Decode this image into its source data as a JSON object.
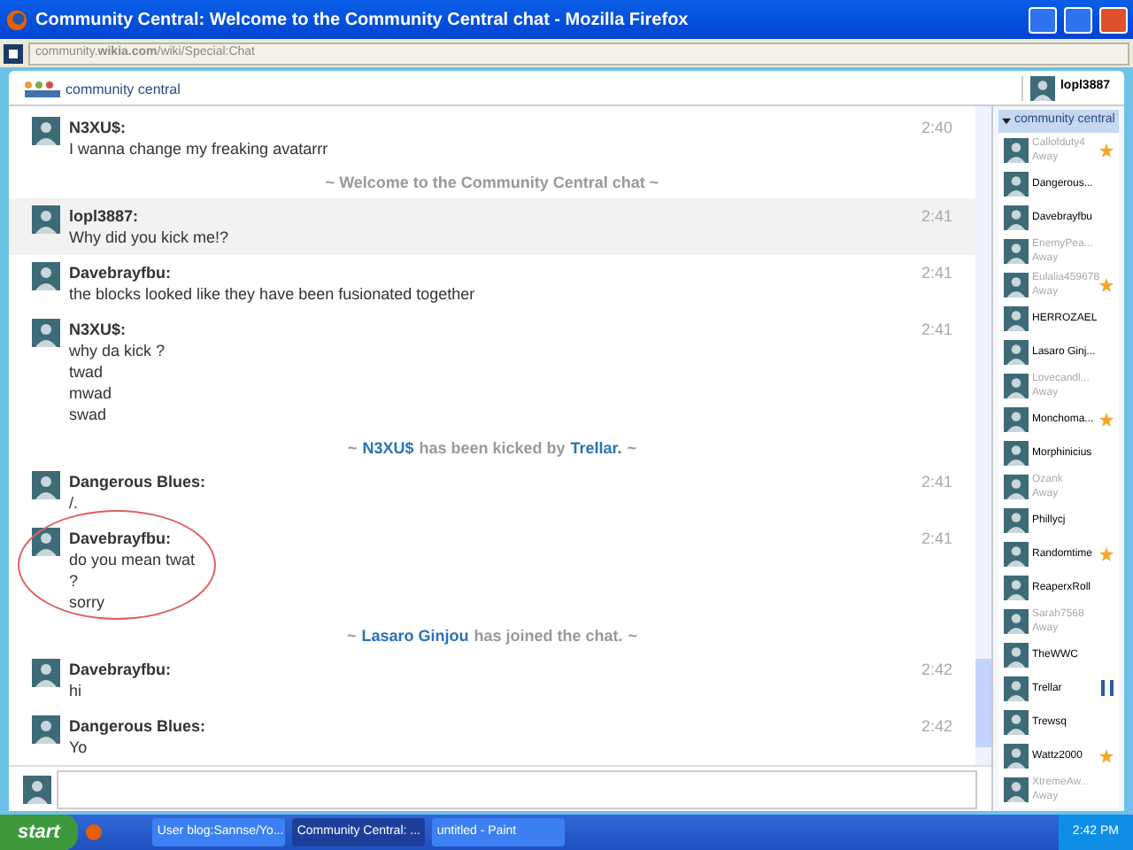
{
  "window": {
    "title": "Community Central: Welcome to the Community Central chat - Mozilla Firefox"
  },
  "address": "community.**wikia.com**/wiki/Special:Chat",
  "header": {
    "logo": "community central",
    "user": "lopl3887"
  },
  "messages": [
    {
      "kind": "message",
      "user": "N3XU$:",
      "time": "2:40",
      "lines": [
        "I wanna change my freaking avatarrr"
      ],
      "highlighted": false,
      "circled": false
    },
    {
      "kind": "notice",
      "parts": [
        {
          "text": "~ Welcome to the Community Central chat ~",
          "link": false
        }
      ]
    },
    {
      "kind": "message",
      "user": "lopl3887:",
      "time": "2:41",
      "lines": [
        "Why did you kick me!?"
      ],
      "highlighted": true,
      "circled": false
    },
    {
      "kind": "message",
      "user": "Davebrayfbu:",
      "time": "2:41",
      "lines": [
        "the blocks looked like they have been fusionated together"
      ],
      "highlighted": false,
      "circled": false
    },
    {
      "kind": "message",
      "user": "N3XU$:",
      "time": "2:41",
      "lines": [
        "why da kick ?",
        "twad",
        "mwad",
        "swad"
      ],
      "highlighted": false,
      "circled": false
    },
    {
      "kind": "notice",
      "parts": [
        {
          "text": "~",
          "link": false
        },
        {
          "text": "N3XU$",
          "link": true
        },
        {
          "text": "has been kicked by",
          "link": false
        },
        {
          "text": "Trellar.",
          "link": true
        },
        {
          "text": "~",
          "link": false
        }
      ]
    },
    {
      "kind": "message",
      "user": "Dangerous Blues:",
      "time": "2:41",
      "lines": [
        "/."
      ],
      "highlighted": false,
      "circled": false
    },
    {
      "kind": "message",
      "user": "Davebrayfbu:",
      "time": "2:41",
      "lines": [
        "do you mean twat",
        "?",
        "sorry"
      ],
      "highlighted": false,
      "circled": true
    },
    {
      "kind": "notice",
      "parts": [
        {
          "text": "~",
          "link": false
        },
        {
          "text": "Lasaro Ginjou",
          "link": true
        },
        {
          "text": "has joined the chat.",
          "link": false
        },
        {
          "text": "~",
          "link": false
        }
      ]
    },
    {
      "kind": "message",
      "user": "Davebrayfbu:",
      "time": "2:42",
      "lines": [
        "hi"
      ],
      "highlighted": false,
      "circled": false
    },
    {
      "kind": "message",
      "user": "Dangerous Blues:",
      "time": "2:42",
      "lines": [
        "Yo"
      ],
      "highlighted": false,
      "circled": false
    }
  ],
  "userlist": {
    "title": "community central",
    "expanded": true,
    "users": [
      {
        "name": "Callofduty4",
        "status": "Away",
        "away": true,
        "starred": true,
        "moderator": false
      },
      {
        "name": "Dangerous...",
        "away": false,
        "starred": false,
        "moderator": false
      },
      {
        "name": "Davebrayfbu",
        "away": false,
        "starred": false,
        "moderator": false
      },
      {
        "name": "EnemyPea...",
        "status": "Away",
        "away": true,
        "starred": false,
        "moderator": false
      },
      {
        "name": "Eulalia459678",
        "status": "Away",
        "away": true,
        "starred": true,
        "moderator": false
      },
      {
        "name": "HERROZAEL",
        "away": false,
        "starred": false,
        "moderator": false
      },
      {
        "name": "Lasaro Ginj...",
        "away": false,
        "starred": false,
        "moderator": false
      },
      {
        "name": "Lovecandl...",
        "status": "Away",
        "away": true,
        "starred": false,
        "moderator": false
      },
      {
        "name": "Monchoma...",
        "away": false,
        "starred": true,
        "moderator": false
      },
      {
        "name": "Morphinicius",
        "away": false,
        "starred": false,
        "moderator": false
      },
      {
        "name": "Ozank",
        "status": "Away",
        "away": true,
        "starred": false,
        "moderator": false
      },
      {
        "name": "Phillycj",
        "away": false,
        "starred": false,
        "moderator": false
      },
      {
        "name": "Randomtime",
        "away": false,
        "starred": true,
        "moderator": false
      },
      {
        "name": "ReaperxRoll",
        "away": false,
        "starred": false,
        "moderator": false
      },
      {
        "name": "Sarah7568",
        "status": "Away",
        "away": true,
        "starred": false,
        "moderator": false
      },
      {
        "name": "TheWWC",
        "away": false,
        "starred": false,
        "moderator": false
      },
      {
        "name": "Trellar",
        "away": false,
        "starred": false,
        "moderator": true
      },
      {
        "name": "Trewsq",
        "away": false,
        "starred": false,
        "moderator": false
      },
      {
        "name": "Wattz2000",
        "away": false,
        "starred": true,
        "moderator": false
      },
      {
        "name": "XtremeAw...",
        "status": "Away",
        "away": true,
        "starred": false,
        "moderator": false
      }
    ]
  },
  "taskbar": {
    "start": "start",
    "tasks": [
      {
        "label": "User blog:Sannse/Yo...",
        "selected": false
      },
      {
        "label": "Community Central: ...",
        "selected": true
      },
      {
        "label": "untitled - Paint",
        "selected": false
      }
    ],
    "clock": "2:42 PM"
  }
}
